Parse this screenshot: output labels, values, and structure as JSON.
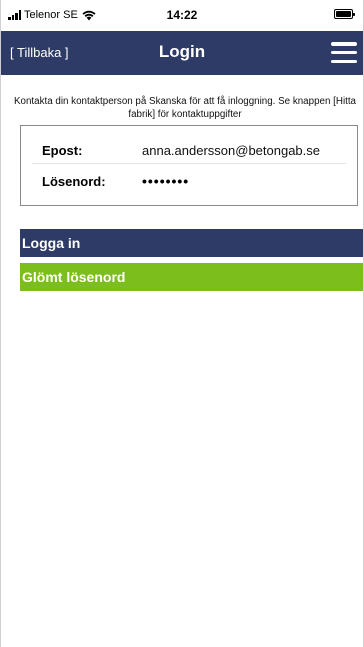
{
  "status_bar": {
    "carrier": "Telenor SE",
    "time": "14:22",
    "signal_icon": "signal-bars-icon",
    "wifi_icon": "wifi-icon",
    "battery_icon": "battery-icon"
  },
  "header": {
    "back_label": "[ Tillbaka ]",
    "title": "Login",
    "menu_icon": "hamburger-menu-icon",
    "color": "#2d3b66"
  },
  "info": {
    "text": "Kontakta din kontaktperson på Skanska för att få inloggning. Se knappen [Hitta fabrik] för kontaktuppgifter"
  },
  "form": {
    "email_label": "Epost:",
    "email_value": "anna.andersson@betongab.se",
    "password_label": "Lösenord:",
    "password_display": "••••••••"
  },
  "buttons": {
    "login_label": "Logga in",
    "login_color": "#2d3b66",
    "forgot_label": "Glömt lösenord",
    "forgot_color": "#7cbf1c"
  }
}
